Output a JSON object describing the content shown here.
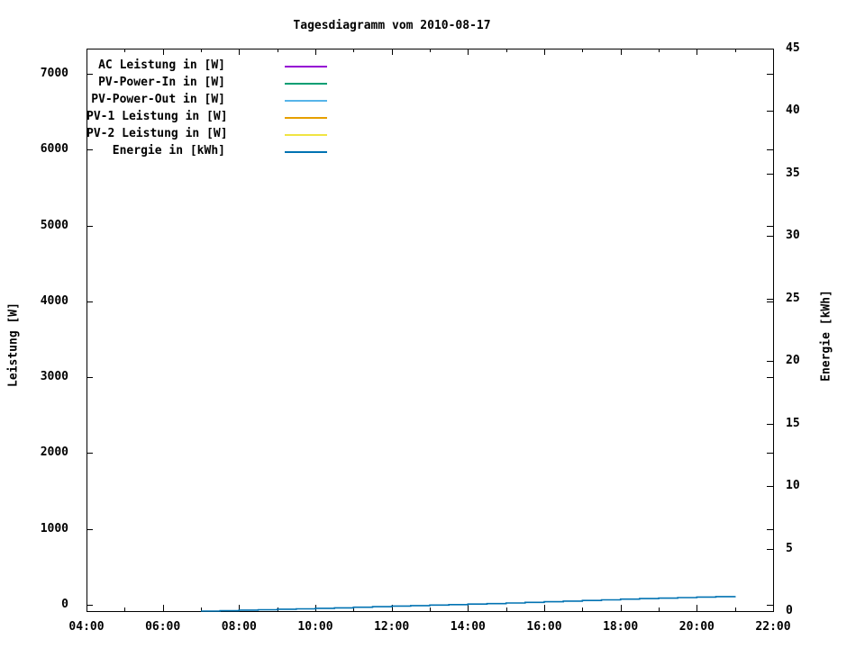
{
  "title": "Tagesdiagramm vom 2010-08-17",
  "colors": {
    "background": "#ffffff",
    "text": "#000000",
    "axis": "#000000"
  },
  "chart_data": {
    "type": "line",
    "title": "Tagesdiagramm vom 2010-08-17",
    "grid": false,
    "legend_position": "top-left",
    "draw_style": "steps",
    "x_axis": {
      "label": "",
      "tick_labels": [
        "04:00",
        "06:00",
        "08:00",
        "10:00",
        "12:00",
        "14:00",
        "16:00",
        "18:00",
        "20:00",
        "22:00"
      ],
      "tick_hours": [
        4,
        6,
        8,
        10,
        12,
        14,
        16,
        18,
        20,
        22
      ],
      "minor_tick_hours": [
        5,
        7,
        9,
        11,
        13,
        15,
        17,
        19,
        21
      ],
      "range_hours": [
        4,
        22
      ]
    },
    "y_left": {
      "label": "Leistung [W]",
      "ticks": [
        0,
        1000,
        2000,
        3000,
        4000,
        5000,
        6000,
        7000
      ],
      "range": [
        0,
        7400
      ]
    },
    "y_right": {
      "label": "Energie [kWh]",
      "ticks": [
        0,
        5,
        10,
        15,
        20,
        25,
        30,
        35,
        40,
        45
      ],
      "range": [
        0,
        45
      ]
    },
    "series": [
      {
        "name": "AC Leistung in [W]",
        "color": "#9400d3",
        "axis": "left",
        "visible_in_plot": false,
        "points": []
      },
      {
        "name": "PV-Power-In in [W]",
        "color": "#009e73",
        "axis": "left",
        "visible_in_plot": false,
        "points": []
      },
      {
        "name": "PV-Power-Out in [W]",
        "color": "#56b4e9",
        "axis": "left",
        "visible_in_plot": false,
        "points": []
      },
      {
        "name": "PV-1 Leistung in [W]",
        "color": "#e69f00",
        "axis": "left",
        "visible_in_plot": false,
        "points": []
      },
      {
        "name": "PV-2 Leistung in [W]",
        "color": "#f0e442",
        "axis": "left",
        "visible_in_plot": false,
        "points": []
      },
      {
        "name": "Energie in [kWh]",
        "color": "#0072b2",
        "axis": "right",
        "visible_in_plot": true,
        "points": [
          [
            7.0,
            0.0
          ],
          [
            7.5,
            0.03
          ],
          [
            8.0,
            0.08
          ],
          [
            8.5,
            0.11
          ],
          [
            9.0,
            0.15
          ],
          [
            9.5,
            0.18
          ],
          [
            10.0,
            0.22
          ],
          [
            10.5,
            0.26
          ],
          [
            11.0,
            0.31
          ],
          [
            11.5,
            0.35
          ],
          [
            12.0,
            0.4
          ],
          [
            12.5,
            0.44
          ],
          [
            13.0,
            0.48
          ],
          [
            13.5,
            0.52
          ],
          [
            14.0,
            0.56
          ],
          [
            14.5,
            0.6
          ],
          [
            15.0,
            0.65
          ],
          [
            15.5,
            0.7
          ],
          [
            16.0,
            0.75
          ],
          [
            16.5,
            0.8
          ],
          [
            17.0,
            0.85
          ],
          [
            17.5,
            0.9
          ],
          [
            18.0,
            0.96
          ],
          [
            18.5,
            1.0
          ],
          [
            19.0,
            1.04
          ],
          [
            19.5,
            1.08
          ],
          [
            20.0,
            1.12
          ],
          [
            20.5,
            1.16
          ],
          [
            21.0,
            1.2
          ]
        ]
      }
    ]
  }
}
